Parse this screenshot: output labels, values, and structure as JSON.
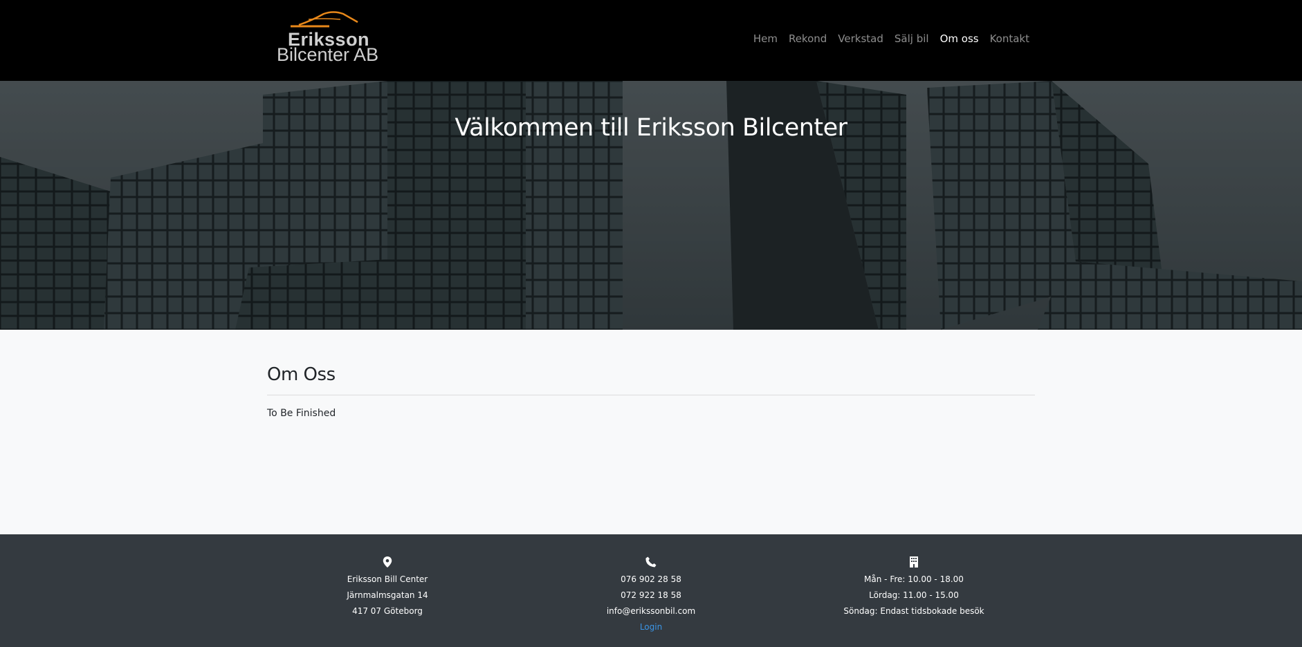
{
  "brand": {
    "line1": "Eriksson",
    "line2": "Bilcenter AB",
    "accent_color": "#e8881a"
  },
  "nav": {
    "items": [
      {
        "label": "Hem",
        "active": false
      },
      {
        "label": "Rekond",
        "active": false
      },
      {
        "label": "Verkstad",
        "active": false
      },
      {
        "label": "Sälj bil",
        "active": false
      },
      {
        "label": "Om oss",
        "active": true
      },
      {
        "label": "Kontakt",
        "active": false
      }
    ]
  },
  "hero": {
    "title": "Välkommen till Eriksson Bilcenter"
  },
  "main": {
    "heading": "Om Oss",
    "body": "To Be Finished"
  },
  "footer": {
    "address": {
      "icon": "map-pin-icon",
      "lines": [
        "Eriksson Bill Center",
        "Järnmalmsgatan 14",
        "417 07 Göteborg"
      ]
    },
    "contact": {
      "icon": "phone-icon",
      "lines": [
        "076 902 28 58",
        "072 922 18 58",
        "info@erikssonbil.com"
      ],
      "login_label": "Login"
    },
    "hours": {
      "icon": "building-icon",
      "lines": [
        "Mån - Fre: 10.00 - 18.00",
        "Lördag: 11.00 - 15.00",
        "Söndag: Endast tidsbokade besök"
      ]
    }
  }
}
